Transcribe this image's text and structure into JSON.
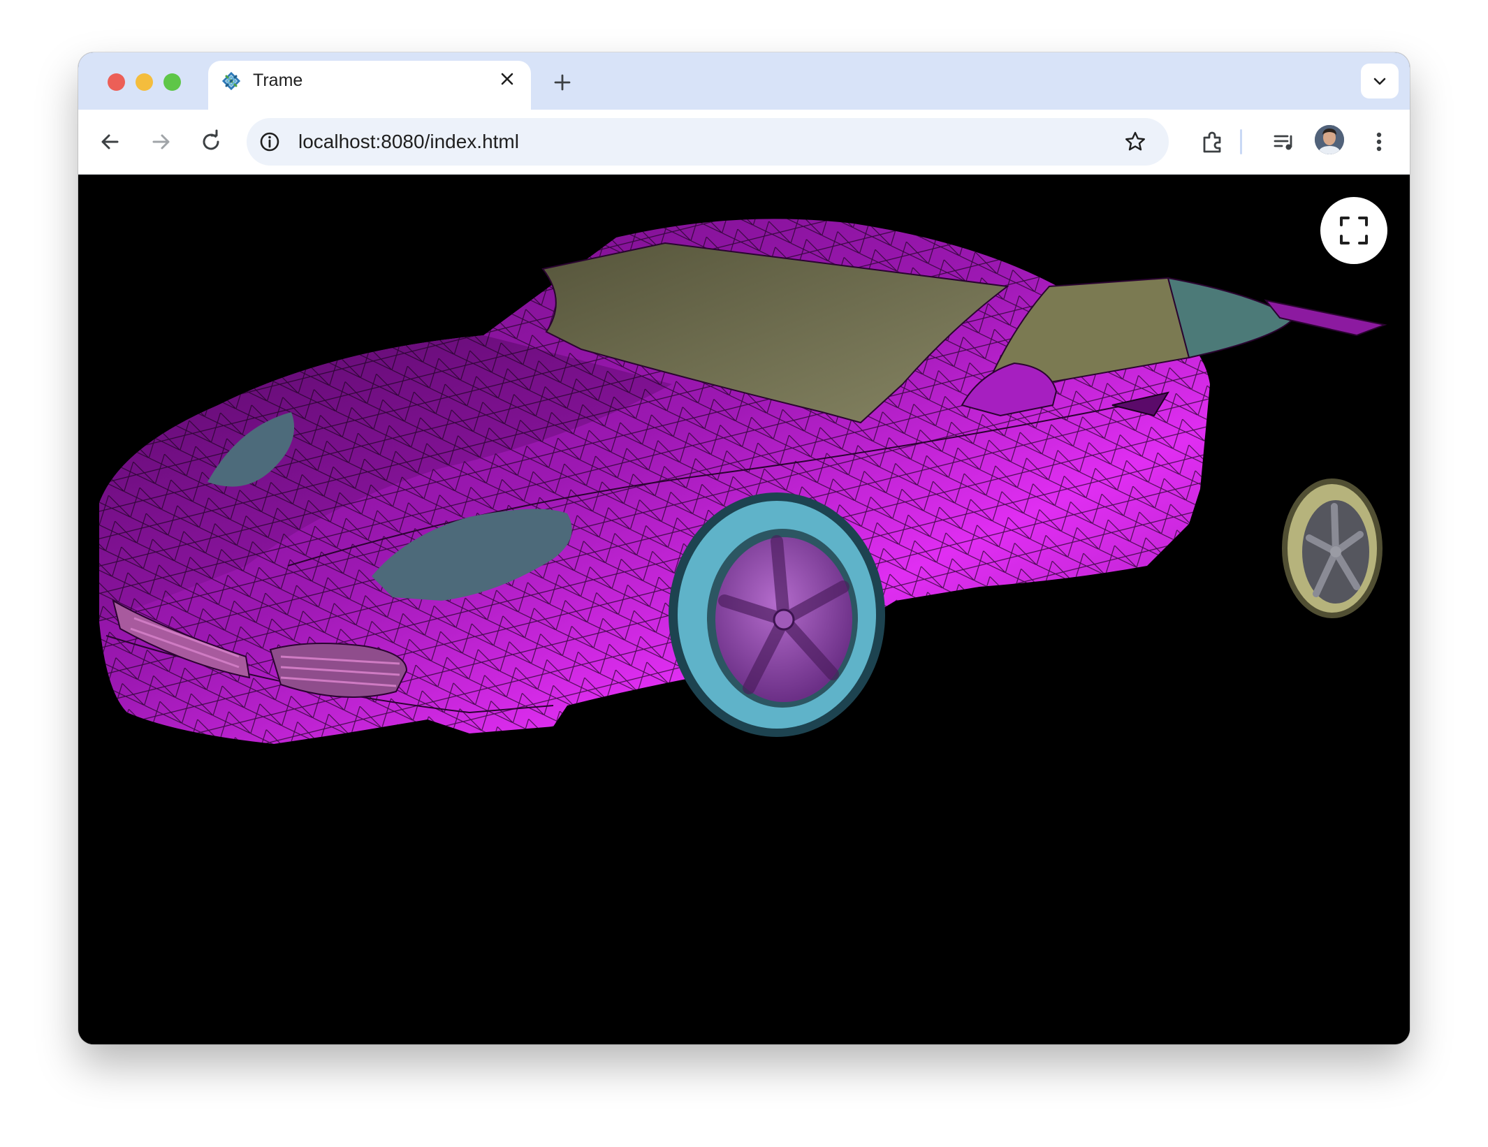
{
  "browser": {
    "tab": {
      "title": "Trame",
      "favicon": "trame-logo-icon"
    },
    "address_bar": {
      "url": "localhost:8080/index.html"
    },
    "icons": {
      "back": "arrow-left-icon",
      "forward": "arrow-right-icon",
      "reload": "reload-icon",
      "site_info": "info-icon",
      "bookmark": "star-icon",
      "extensions": "puzzle-icon",
      "media": "media-controls-icon",
      "profile": "avatar",
      "menu": "kebab-menu-icon",
      "new_tab": "plus-icon",
      "tab_search": "chevron-down-icon"
    }
  },
  "viewer": {
    "background": "#000000",
    "model": "car-mesh",
    "body_color": "#c018d8",
    "glass_color": "#7b7a55",
    "lights_color": "#4d6a7a",
    "tire_front_color": "#5fb3c9",
    "tire_rear_color": "#b6b37c",
    "wireframe_overlay": true,
    "controls": {
      "fullscreen": "fullscreen-icon"
    }
  }
}
